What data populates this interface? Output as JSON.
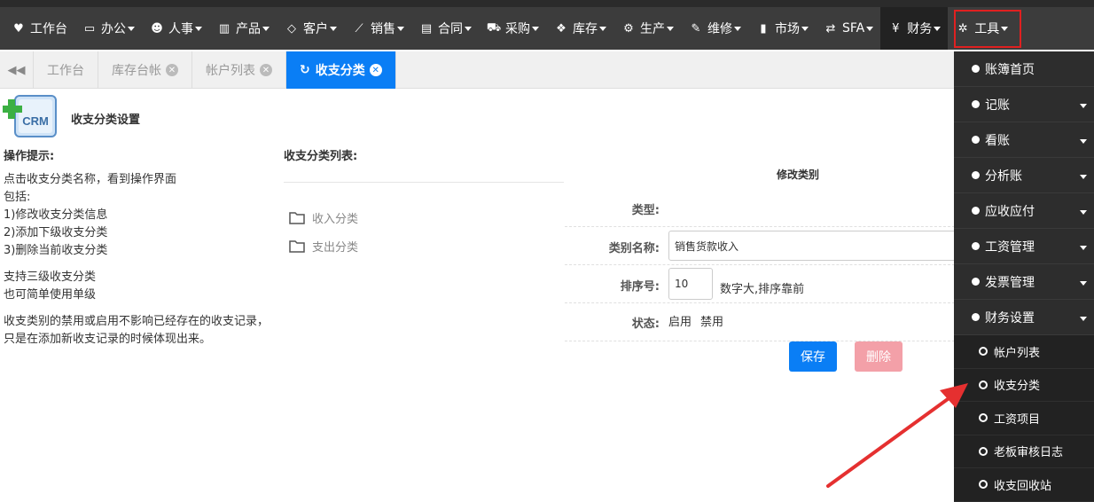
{
  "nav": {
    "items": [
      {
        "icon": "heart-icon",
        "label": "工作台"
      },
      {
        "icon": "laptop-icon",
        "label": "办公"
      },
      {
        "icon": "users-icon",
        "label": "人事"
      },
      {
        "icon": "barcode-icon",
        "label": "产品"
      },
      {
        "icon": "diamond-icon",
        "label": "客户"
      },
      {
        "icon": "line-chart-icon",
        "label": "销售"
      },
      {
        "icon": "newspaper-icon",
        "label": "合同"
      },
      {
        "icon": "cart-icon",
        "label": "采购"
      },
      {
        "icon": "cubes-icon",
        "label": "库存"
      },
      {
        "icon": "cogs-icon",
        "label": "生产"
      },
      {
        "icon": "wrench-icon",
        "label": "维修"
      },
      {
        "icon": "bookmark-icon",
        "label": "市场"
      },
      {
        "icon": "retweet-icon",
        "label": "SFA"
      },
      {
        "icon": "yen-icon",
        "label": "财务"
      },
      {
        "icon": "gear-icon",
        "label": "工具"
      }
    ]
  },
  "tabs": {
    "items": [
      {
        "label": "工作台"
      },
      {
        "label": "库存台帐"
      },
      {
        "label": "帐户列表"
      },
      {
        "label": "收支分类"
      }
    ]
  },
  "page": {
    "logo_text": "CRM",
    "title": "收支分类设置"
  },
  "tips": {
    "title": "操作提示:",
    "line1": "点击收支分类名称，看到操作界面",
    "line2": "包括:",
    "line3": "1)修改收支分类信息",
    "line4": "2)添加下级收支分类",
    "line5": "3)删除当前收支分类",
    "line6": "支持三级收支分类",
    "line7": "也可简单使用单级",
    "line8": "收支类别的禁用或启用不影响已经存在的收支记录，只是在添加新收支记录的时候体现出来。"
  },
  "category_list": {
    "title": "收支分类列表:",
    "items": [
      {
        "label": "收入分类"
      },
      {
        "label": "支出分类"
      }
    ]
  },
  "form": {
    "title": "修改类别",
    "type_label": "类型:",
    "name_label": "类别名称:",
    "name_value": "销售货款收入",
    "sort_label": "排序号:",
    "sort_value": "10",
    "sort_hint": "数字大,排序靠前",
    "status_label": "状态:",
    "status_enable": "启用",
    "status_disable": "禁用",
    "save_label": "保存",
    "delete_label": "删除"
  },
  "sidebar": {
    "items": [
      {
        "label": "账簿首页"
      },
      {
        "label": "记账"
      },
      {
        "label": "看账"
      },
      {
        "label": "分析账"
      },
      {
        "label": "应收应付"
      },
      {
        "label": "工资管理"
      },
      {
        "label": "发票管理"
      },
      {
        "label": "财务设置"
      }
    ],
    "subitems": [
      {
        "label": "帐户列表"
      },
      {
        "label": "收支分类"
      },
      {
        "label": "工资项目"
      },
      {
        "label": "老板审核日志"
      },
      {
        "label": "收支回收站"
      }
    ]
  },
  "colors": {
    "accent": "#0a7ef5",
    "nav_bg": "#3c3c3c",
    "sidebar_bg": "#2d2d2d",
    "highlight": "#e02020",
    "delete_btn": "#f3a0a8"
  }
}
